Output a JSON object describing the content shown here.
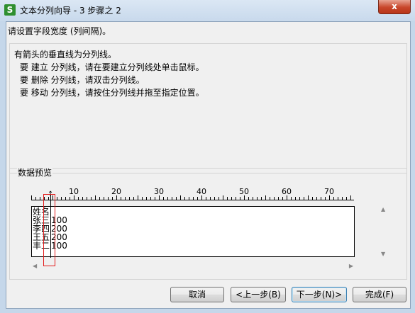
{
  "window": {
    "title": "文本分列向导 - 3 步骤之 2",
    "icon": "spreadsheet-app-icon",
    "close_label": "x"
  },
  "instruction": "请设置字段宽度 (列间隔)。",
  "hints": {
    "heading": "有箭头的垂直线为分列线。",
    "lines": [
      "要  建立  分列线，请在要建立分列线处单击鼠标。",
      "要  删除  分列线，请双击分列线。",
      "要  移动  分列线，请按住分列线并拖至指定位置。"
    ]
  },
  "preview": {
    "label": "数据预览",
    "ruler_labels": [
      "10",
      "20",
      "30",
      "40",
      "50",
      "60",
      "70"
    ],
    "rows": [
      [
        "姓名",
        ""
      ],
      [
        "张三",
        "100"
      ],
      [
        "李四",
        "200"
      ],
      [
        "王五",
        "200"
      ],
      [
        "丰二",
        "100"
      ]
    ],
    "divider_marker": "↑"
  },
  "buttons": {
    "cancel": "取消",
    "back": "<上一步(B)",
    "next": "下一步(N)>",
    "finish": "完成(F)"
  },
  "colors": {
    "highlight": "#e31c1c",
    "close_button": "#c8462b",
    "app_icon": "#2f8f2f"
  }
}
